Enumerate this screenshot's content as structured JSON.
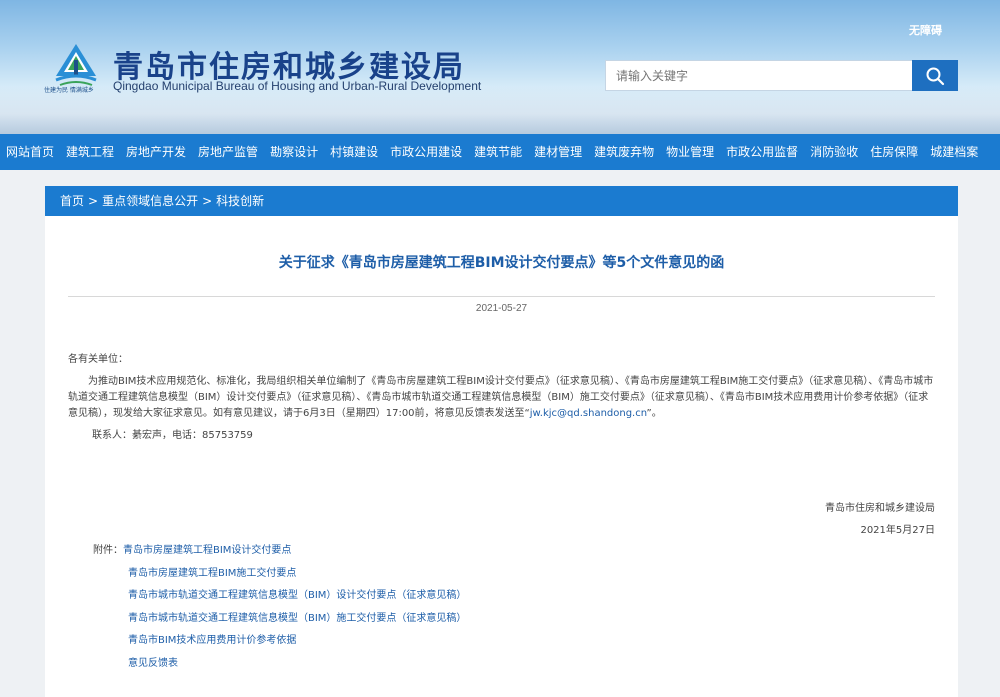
{
  "header": {
    "accessibility_link": "无障碍",
    "site_title": "青岛市住房和城乡建设局",
    "site_subtitle": "Qingdao Municipal Bureau of Housing and Urban-Rural Development",
    "logo_slogan": "住建为民 情满城乡",
    "search": {
      "placeholder": "请输入关键字",
      "button_icon": "search-icon"
    }
  },
  "nav": {
    "items": [
      "网站首页",
      "建筑工程",
      "房地产开发",
      "房地产监管",
      "勘察设计",
      "村镇建设",
      "市政公用建设",
      "建筑节能",
      "建材管理",
      "建筑废弃物",
      "物业管理",
      "市政公用监督",
      "消防验收",
      "住房保障",
      "城建档案"
    ]
  },
  "breadcrumb": {
    "home": "首页",
    "level1": "重点领域信息公开",
    "level2": "科技创新",
    "separator": ">"
  },
  "article": {
    "title": "关于征求《青岛市房屋建筑工程BIM设计交付要点》等5个文件意见的函",
    "date": "2021-05-27",
    "salutation": "各有关单位：",
    "paragraph_start": "为推动BIM技术应用规范化、标准化，我局组织相关单位编制了《青岛市房屋建筑工程BIM设计交付要点》（征求意见稿）、《青岛市房屋建筑工程BIM施工交付要点》（征求意见稿）、《青岛市城市轨道交通工程建筑信息模型（BIM）设计交付要点》（征求意见稿）、《青岛市城市轨道交通工程建筑信息模型（BIM）施工交付要点》（征求意见稿）、《青岛市BIM技术应用费用计价参考依据》（征求意见稿），现发给大家征求意见。如有意见建议，请于6月3日（星期四）17:00前，将意见反馈表发送至“",
    "email": "jw.kjc@qd.shandong.cn",
    "paragraph_end": "”。",
    "contact": "联系人：綦宏声，电话：85753759",
    "signature_org": "青岛市住房和城乡建设局",
    "signature_date": "2021年5月27日"
  },
  "attachments": {
    "prefix": "附件：",
    "items": [
      "青岛市房屋建筑工程BIM设计交付要点",
      "青岛市房屋建筑工程BIM施工交付要点",
      "青岛市城市轨道交通工程建筑信息模型（BIM）设计交付要点（征求意见稿）",
      "青岛市城市轨道交通工程建筑信息模型（BIM）施工交付要点（征求意见稿）",
      "青岛市BIM技术应用费用计价参考依据",
      "意见反馈表"
    ]
  },
  "colors": {
    "nav_bg": "#1b7bd0",
    "title_blue": "#19428a",
    "link_blue": "#1e5ea8"
  }
}
